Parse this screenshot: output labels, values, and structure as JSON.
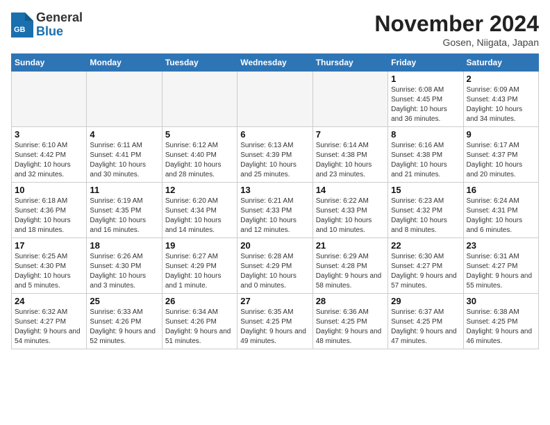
{
  "header": {
    "logo_general": "General",
    "logo_blue": "Blue",
    "month_title": "November 2024",
    "location": "Gosen, Niigata, Japan"
  },
  "weekdays": [
    "Sunday",
    "Monday",
    "Tuesday",
    "Wednesday",
    "Thursday",
    "Friday",
    "Saturday"
  ],
  "weeks": [
    [
      {
        "day": "",
        "info": ""
      },
      {
        "day": "",
        "info": ""
      },
      {
        "day": "",
        "info": ""
      },
      {
        "day": "",
        "info": ""
      },
      {
        "day": "",
        "info": ""
      },
      {
        "day": "1",
        "info": "Sunrise: 6:08 AM\nSunset: 4:45 PM\nDaylight: 10 hours and 36 minutes."
      },
      {
        "day": "2",
        "info": "Sunrise: 6:09 AM\nSunset: 4:43 PM\nDaylight: 10 hours and 34 minutes."
      }
    ],
    [
      {
        "day": "3",
        "info": "Sunrise: 6:10 AM\nSunset: 4:42 PM\nDaylight: 10 hours and 32 minutes."
      },
      {
        "day": "4",
        "info": "Sunrise: 6:11 AM\nSunset: 4:41 PM\nDaylight: 10 hours and 30 minutes."
      },
      {
        "day": "5",
        "info": "Sunrise: 6:12 AM\nSunset: 4:40 PM\nDaylight: 10 hours and 28 minutes."
      },
      {
        "day": "6",
        "info": "Sunrise: 6:13 AM\nSunset: 4:39 PM\nDaylight: 10 hours and 25 minutes."
      },
      {
        "day": "7",
        "info": "Sunrise: 6:14 AM\nSunset: 4:38 PM\nDaylight: 10 hours and 23 minutes."
      },
      {
        "day": "8",
        "info": "Sunrise: 6:16 AM\nSunset: 4:38 PM\nDaylight: 10 hours and 21 minutes."
      },
      {
        "day": "9",
        "info": "Sunrise: 6:17 AM\nSunset: 4:37 PM\nDaylight: 10 hours and 20 minutes."
      }
    ],
    [
      {
        "day": "10",
        "info": "Sunrise: 6:18 AM\nSunset: 4:36 PM\nDaylight: 10 hours and 18 minutes."
      },
      {
        "day": "11",
        "info": "Sunrise: 6:19 AM\nSunset: 4:35 PM\nDaylight: 10 hours and 16 minutes."
      },
      {
        "day": "12",
        "info": "Sunrise: 6:20 AM\nSunset: 4:34 PM\nDaylight: 10 hours and 14 minutes."
      },
      {
        "day": "13",
        "info": "Sunrise: 6:21 AM\nSunset: 4:33 PM\nDaylight: 10 hours and 12 minutes."
      },
      {
        "day": "14",
        "info": "Sunrise: 6:22 AM\nSunset: 4:33 PM\nDaylight: 10 hours and 10 minutes."
      },
      {
        "day": "15",
        "info": "Sunrise: 6:23 AM\nSunset: 4:32 PM\nDaylight: 10 hours and 8 minutes."
      },
      {
        "day": "16",
        "info": "Sunrise: 6:24 AM\nSunset: 4:31 PM\nDaylight: 10 hours and 6 minutes."
      }
    ],
    [
      {
        "day": "17",
        "info": "Sunrise: 6:25 AM\nSunset: 4:30 PM\nDaylight: 10 hours and 5 minutes."
      },
      {
        "day": "18",
        "info": "Sunrise: 6:26 AM\nSunset: 4:30 PM\nDaylight: 10 hours and 3 minutes."
      },
      {
        "day": "19",
        "info": "Sunrise: 6:27 AM\nSunset: 4:29 PM\nDaylight: 10 hours and 1 minute."
      },
      {
        "day": "20",
        "info": "Sunrise: 6:28 AM\nSunset: 4:29 PM\nDaylight: 10 hours and 0 minutes."
      },
      {
        "day": "21",
        "info": "Sunrise: 6:29 AM\nSunset: 4:28 PM\nDaylight: 9 hours and 58 minutes."
      },
      {
        "day": "22",
        "info": "Sunrise: 6:30 AM\nSunset: 4:27 PM\nDaylight: 9 hours and 57 minutes."
      },
      {
        "day": "23",
        "info": "Sunrise: 6:31 AM\nSunset: 4:27 PM\nDaylight: 9 hours and 55 minutes."
      }
    ],
    [
      {
        "day": "24",
        "info": "Sunrise: 6:32 AM\nSunset: 4:27 PM\nDaylight: 9 hours and 54 minutes."
      },
      {
        "day": "25",
        "info": "Sunrise: 6:33 AM\nSunset: 4:26 PM\nDaylight: 9 hours and 52 minutes."
      },
      {
        "day": "26",
        "info": "Sunrise: 6:34 AM\nSunset: 4:26 PM\nDaylight: 9 hours and 51 minutes."
      },
      {
        "day": "27",
        "info": "Sunrise: 6:35 AM\nSunset: 4:25 PM\nDaylight: 9 hours and 49 minutes."
      },
      {
        "day": "28",
        "info": "Sunrise: 6:36 AM\nSunset: 4:25 PM\nDaylight: 9 hours and 48 minutes."
      },
      {
        "day": "29",
        "info": "Sunrise: 6:37 AM\nSunset: 4:25 PM\nDaylight: 9 hours and 47 minutes."
      },
      {
        "day": "30",
        "info": "Sunrise: 6:38 AM\nSunset: 4:25 PM\nDaylight: 9 hours and 46 minutes."
      }
    ]
  ]
}
